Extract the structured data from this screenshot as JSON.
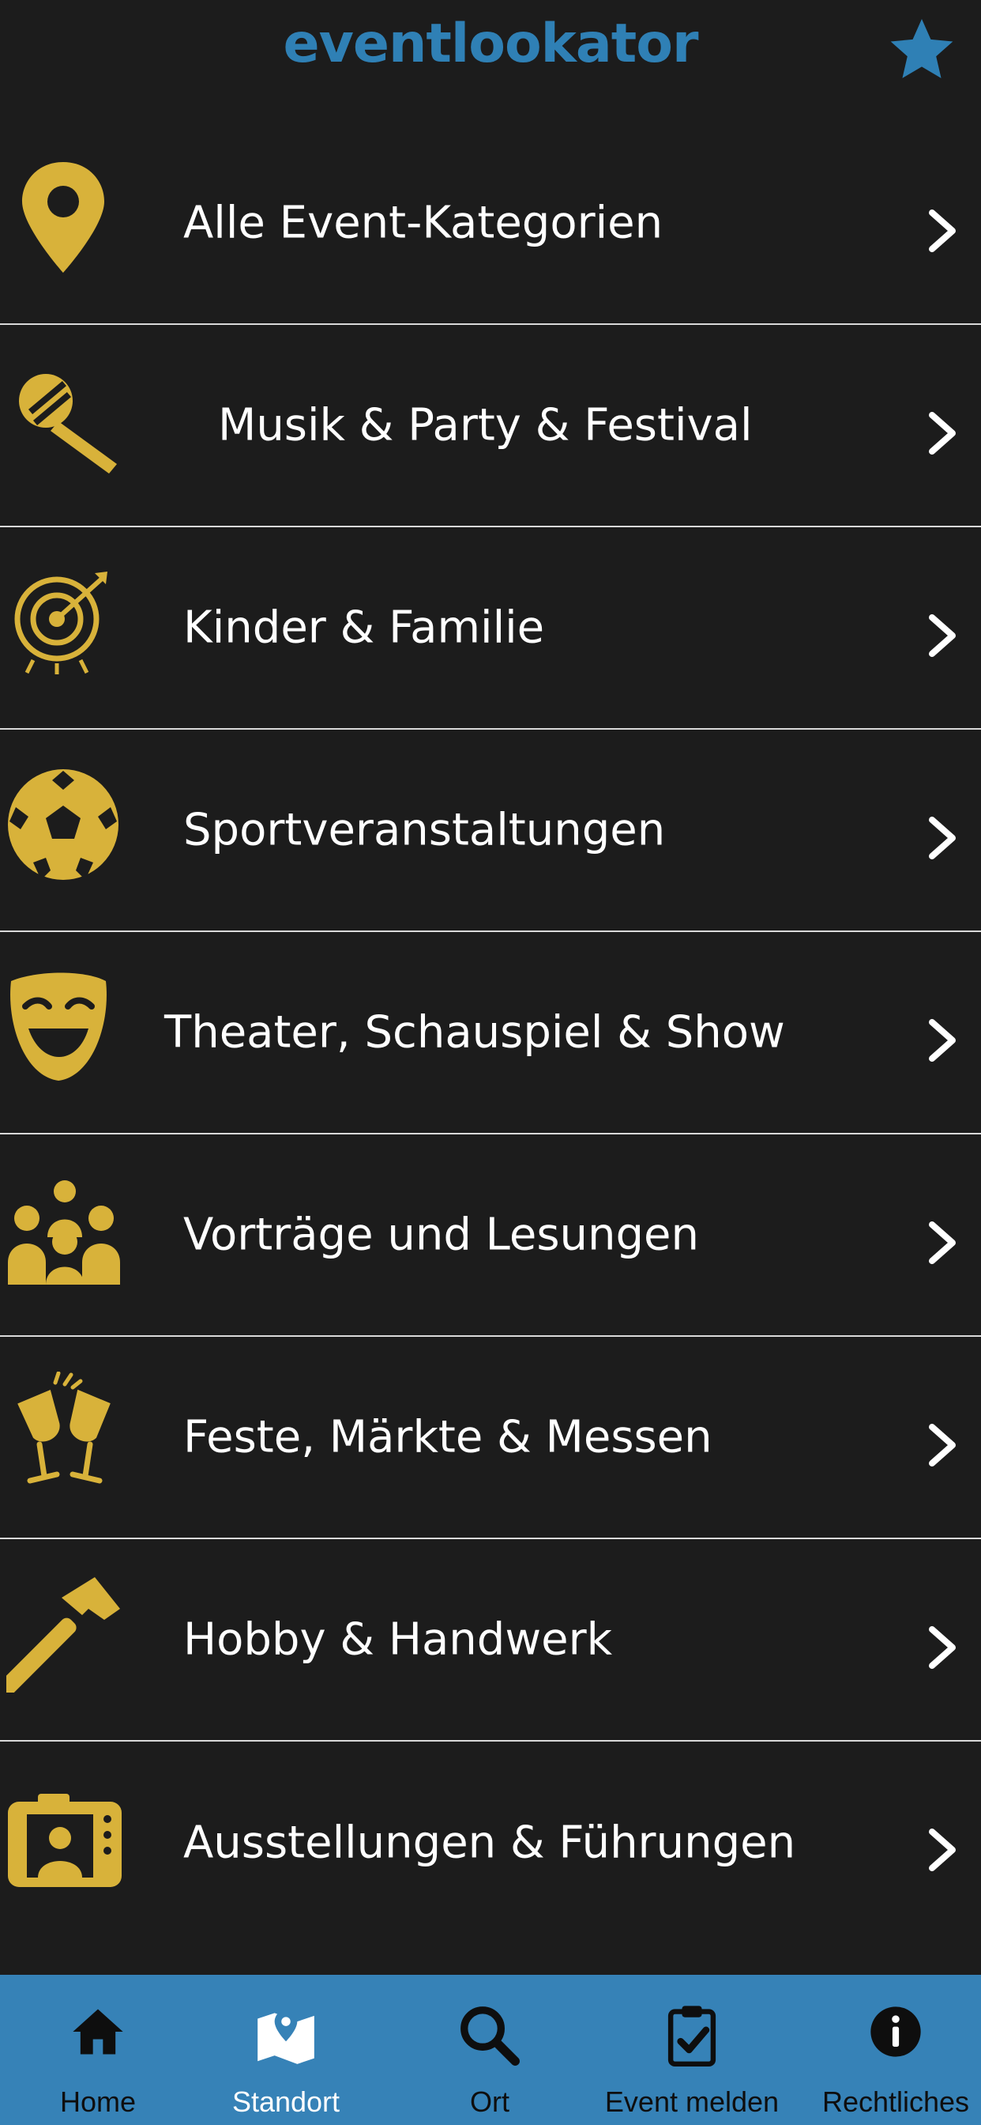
{
  "colors": {
    "background": "#1c1c1c",
    "accent_blue": "#2f80b5",
    "icon_gold": "#d8b23a",
    "text_white": "#ffffff",
    "divider": "#d9d9d9",
    "nav_bg": "#3682b7",
    "nav_text_dark": "#0e0e0e"
  },
  "header": {
    "title": "eventlookator",
    "favorite_icon": "star-icon"
  },
  "categories": [
    {
      "label": "Alle Event-Kategorien",
      "icon": "map-pin-icon"
    },
    {
      "label": "Musik & Party & Festival",
      "icon": "microphone-icon"
    },
    {
      "label": "Kinder & Familie",
      "icon": "target-icon"
    },
    {
      "label": "Sportveranstaltungen",
      "icon": "soccer-ball-icon"
    },
    {
      "label": "Theater, Schauspiel & Show",
      "icon": "theater-mask-icon"
    },
    {
      "label": "Vorträge und Lesungen",
      "icon": "audience-icon"
    },
    {
      "label": "Feste, Märkte & Messen",
      "icon": "toast-glasses-icon"
    },
    {
      "label": "Hobby & Handwerk",
      "icon": "hammer-icon"
    },
    {
      "label": "Ausstellungen & Führungen",
      "icon": "camera-portrait-icon"
    }
  ],
  "nav": {
    "items": [
      {
        "label": "Home",
        "icon": "home-icon"
      },
      {
        "label": "Standort",
        "icon": "map-location-icon",
        "active": true
      },
      {
        "label": "Ort",
        "icon": "search-icon"
      },
      {
        "label": "Event melden",
        "icon": "clipboard-check-icon"
      },
      {
        "label": "Rechtliches",
        "icon": "info-icon"
      }
    ]
  }
}
